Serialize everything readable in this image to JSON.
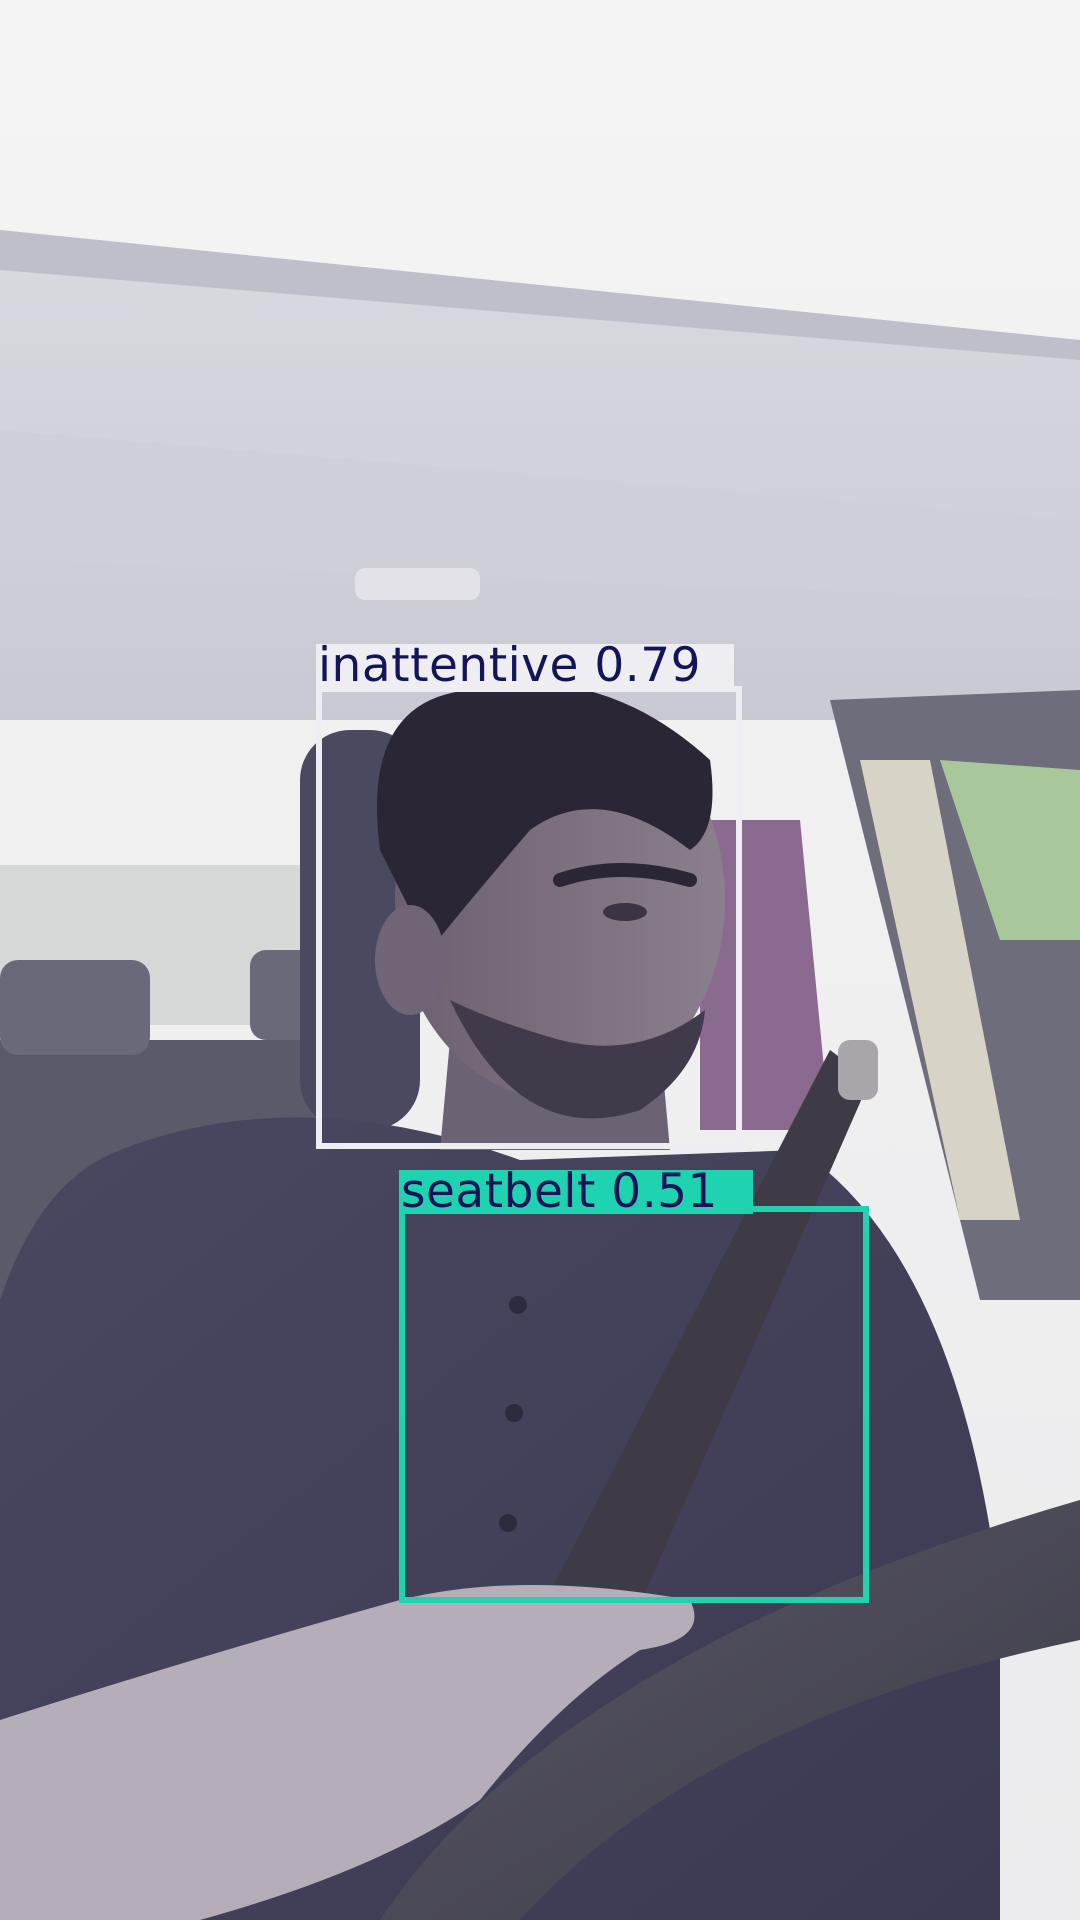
{
  "image": {
    "description_hidden": false
  },
  "detections": [
    {
      "class": "inattentive",
      "confidence": "0.79",
      "label": "inattentive  0.79",
      "box_color": "#eeeef2",
      "label_bg": "#eeeef2",
      "text_color": "#14145a"
    },
    {
      "class": "seatbelt",
      "confidence": "0.51",
      "label": "seatbelt  0.51",
      "box_color": "#1fd2b0",
      "label_bg": "#1fd2b0",
      "text_color": "#14145a"
    }
  ]
}
